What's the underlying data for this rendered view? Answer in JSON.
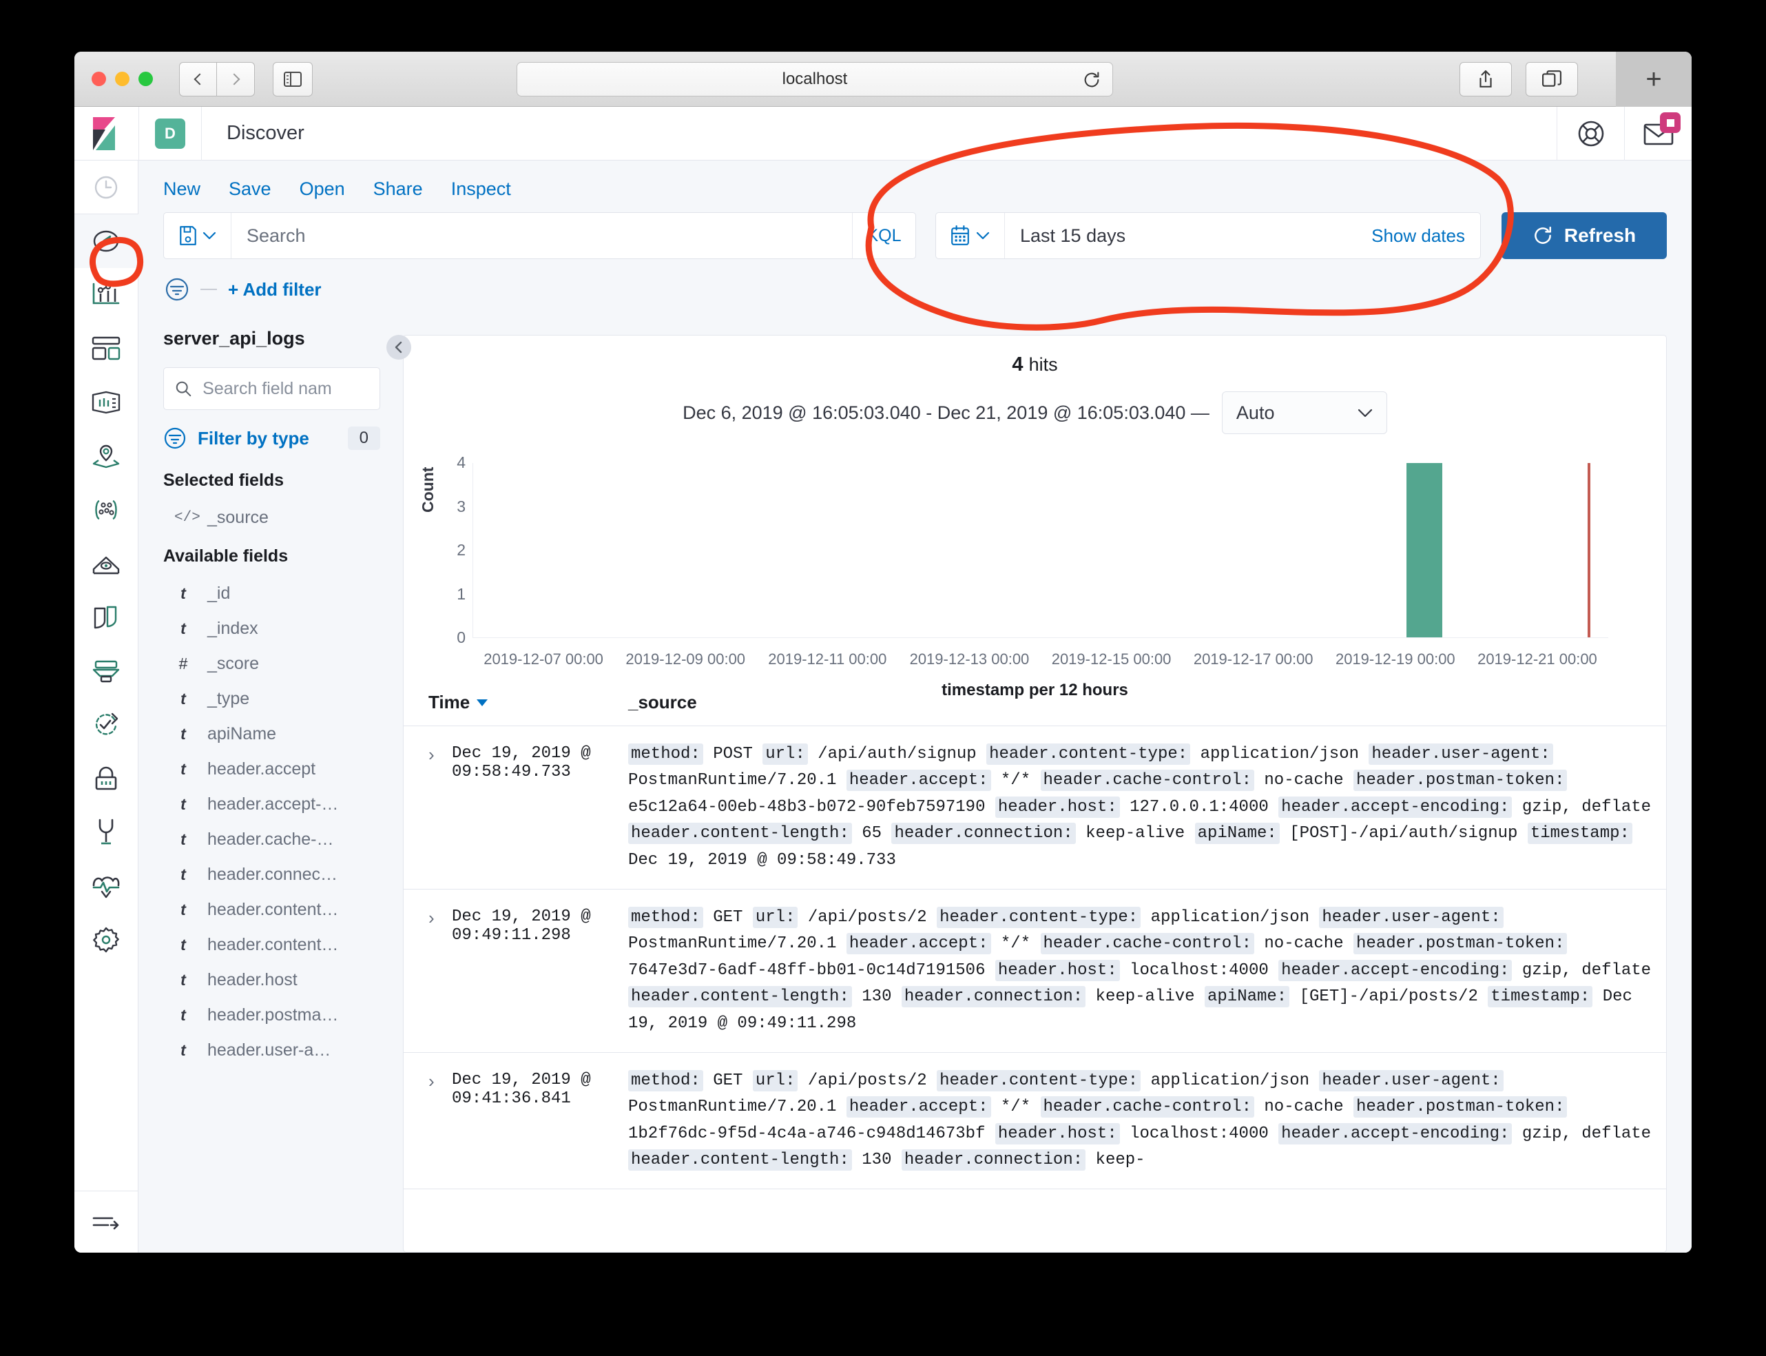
{
  "browser": {
    "url": "localhost",
    "back_label": "Back",
    "forward_label": "Forward",
    "sidebar_label": "Sidebar",
    "share_label": "Share",
    "tabs_label": "Tab Overview",
    "newtab_label": "+"
  },
  "header": {
    "app_badge": "D",
    "app_title": "Discover"
  },
  "menu": {
    "items": [
      "New",
      "Save",
      "Open",
      "Share",
      "Inspect"
    ]
  },
  "query": {
    "search_placeholder": "Search",
    "search_value": "",
    "kql_label": "KQL",
    "date_range": "Last 15 days",
    "show_dates_label": "Show dates",
    "refresh_label": "Refresh"
  },
  "filters": {
    "add_filter_label": "+ Add filter"
  },
  "fields": {
    "index_pattern": "server_api_logs",
    "search_placeholder": "Search field nam",
    "filter_by_type_label": "Filter by type",
    "filter_type_count": "0",
    "selected_heading": "Selected fields",
    "selected": [
      {
        "type": "_source",
        "name": "_source"
      }
    ],
    "available_heading": "Available fields",
    "available": [
      {
        "type": "t",
        "name": "_id"
      },
      {
        "type": "t",
        "name": "_index"
      },
      {
        "type": "#",
        "name": "_score"
      },
      {
        "type": "t",
        "name": "_type"
      },
      {
        "type": "t",
        "name": "apiName"
      },
      {
        "type": "t",
        "name": "header.accept"
      },
      {
        "type": "t",
        "name": "header.accept-…"
      },
      {
        "type": "t",
        "name": "header.cache-…"
      },
      {
        "type": "t",
        "name": "header.connec…"
      },
      {
        "type": "t",
        "name": "header.content…"
      },
      {
        "type": "t",
        "name": "header.content…"
      },
      {
        "type": "t",
        "name": "header.host"
      },
      {
        "type": "t",
        "name": "header.postma…"
      },
      {
        "type": "t",
        "name": "header.user-a…"
      }
    ]
  },
  "discover": {
    "hits_count": "4",
    "hits_word": "hits",
    "range_text": "Dec 6, 2019 @ 16:05:03.040 - Dec 21, 2019 @ 16:05:03.040 —",
    "interval_value": "Auto",
    "table_headers": {
      "time": "Time",
      "source": "_source"
    }
  },
  "chart_data": {
    "type": "bar",
    "title": "",
    "xlabel": "timestamp per 12 hours",
    "ylabel": "Count",
    "ylim": [
      0,
      4
    ],
    "yticks": [
      "0",
      "1",
      "2",
      "3",
      "4"
    ],
    "xticks": [
      "2019-12-07 00:00",
      "2019-12-09 00:00",
      "2019-12-11 00:00",
      "2019-12-13 00:00",
      "2019-12-15 00:00",
      "2019-12-17 00:00",
      "2019-12-19 00:00",
      "2019-12-21 00:00"
    ],
    "grid": false,
    "bar_color": "#54a68f",
    "marker_color": "#c35b52",
    "categories": [
      "2019-12-19 00:00"
    ],
    "values": [
      4
    ],
    "bars": [
      {
        "x": "2019-12-19 00:00",
        "value": 4,
        "left_pct": 82.2,
        "width_pct": 3.2
      }
    ],
    "markers": [
      {
        "label": "now",
        "left_pct": 98.2
      }
    ]
  },
  "documents": [
    {
      "time": "Dec 19, 2019 @ 09:58:49.733",
      "pairs": [
        {
          "key": "method:",
          "value": "POST"
        },
        {
          "key": "url:",
          "value": "/api/auth/signup"
        },
        {
          "key": "header.content-type:",
          "value": "application/json"
        },
        {
          "key": "header.user-agent:",
          "value": "PostmanRuntime/7.20.1"
        },
        {
          "key": "header.accept:",
          "value": "*/*"
        },
        {
          "key": "header.cache-control:",
          "value": "no-cache"
        },
        {
          "key": "header.postman-token:",
          "value": "e5c12a64-00eb-48b3-b072-90feb7597190"
        },
        {
          "key": "header.host:",
          "value": "127.0.0.1:4000"
        },
        {
          "key": "header.accept-encoding:",
          "value": "gzip, deflate"
        },
        {
          "key": "header.content-length:",
          "value": "65"
        },
        {
          "key": "header.connection:",
          "value": "keep-alive"
        },
        {
          "key": "apiName:",
          "value": "[POST]-/api/auth/signup"
        },
        {
          "key": "timestamp:",
          "value": "Dec 19, 2019 @ 09:58:49.733"
        }
      ]
    },
    {
      "time": "Dec 19, 2019 @ 09:49:11.298",
      "pairs": [
        {
          "key": "method:",
          "value": "GET"
        },
        {
          "key": "url:",
          "value": "/api/posts/2"
        },
        {
          "key": "header.content-type:",
          "value": "application/json"
        },
        {
          "key": "header.user-agent:",
          "value": "PostmanRuntime/7.20.1"
        },
        {
          "key": "header.accept:",
          "value": "*/*"
        },
        {
          "key": "header.cache-control:",
          "value": "no-cache"
        },
        {
          "key": "header.postman-token:",
          "value": "7647e3d7-6adf-48ff-bb01-0c14d7191506"
        },
        {
          "key": "header.host:",
          "value": "localhost:4000"
        },
        {
          "key": "header.accept-encoding:",
          "value": "gzip, deflate"
        },
        {
          "key": "header.content-length:",
          "value": "130"
        },
        {
          "key": "header.connection:",
          "value": "keep-alive"
        },
        {
          "key": "apiName:",
          "value": "[GET]-/api/posts/2"
        },
        {
          "key": "timestamp:",
          "value": "Dec 19, 2019 @ 09:49:11.298"
        }
      ]
    },
    {
      "time": "Dec 19, 2019 @ 09:41:36.841",
      "pairs": [
        {
          "key": "method:",
          "value": "GET"
        },
        {
          "key": "url:",
          "value": "/api/posts/2"
        },
        {
          "key": "header.content-type:",
          "value": "application/json"
        },
        {
          "key": "header.user-agent:",
          "value": "PostmanRuntime/7.20.1"
        },
        {
          "key": "header.accept:",
          "value": "*/*"
        },
        {
          "key": "header.cache-control:",
          "value": "no-cache"
        },
        {
          "key": "header.postman-token:",
          "value": "1b2f76dc-9f5d-4c4a-a746-c948d14673bf"
        },
        {
          "key": "header.host:",
          "value": "localhost:4000"
        },
        {
          "key": "header.accept-encoding:",
          "value": "gzip, deflate"
        },
        {
          "key": "header.content-length:",
          "value": "130"
        },
        {
          "key": "header.connection:",
          "value": "keep-"
        }
      ]
    }
  ],
  "rail": {
    "items": [
      {
        "name": "recently-viewed",
        "label": "Recently viewed"
      },
      {
        "name": "discover",
        "label": "Discover"
      },
      {
        "name": "visualize",
        "label": "Visualize"
      },
      {
        "name": "dashboard",
        "label": "Dashboard"
      },
      {
        "name": "canvas",
        "label": "Canvas"
      },
      {
        "name": "maps",
        "label": "Maps"
      },
      {
        "name": "machine-learning",
        "label": "Machine Learning"
      },
      {
        "name": "infrastructure",
        "label": "Infrastructure"
      },
      {
        "name": "logs",
        "label": "Logs"
      },
      {
        "name": "apm",
        "label": "APM"
      },
      {
        "name": "uptime",
        "label": "Uptime"
      },
      {
        "name": "siem",
        "label": "SIEM"
      },
      {
        "name": "dev-tools",
        "label": "Dev Tools"
      },
      {
        "name": "monitoring",
        "label": "Monitoring"
      },
      {
        "name": "management",
        "label": "Management"
      },
      {
        "name": "collapse-nav",
        "label": "Collapse"
      }
    ]
  },
  "annotation": {
    "color": "#f03c1e"
  }
}
